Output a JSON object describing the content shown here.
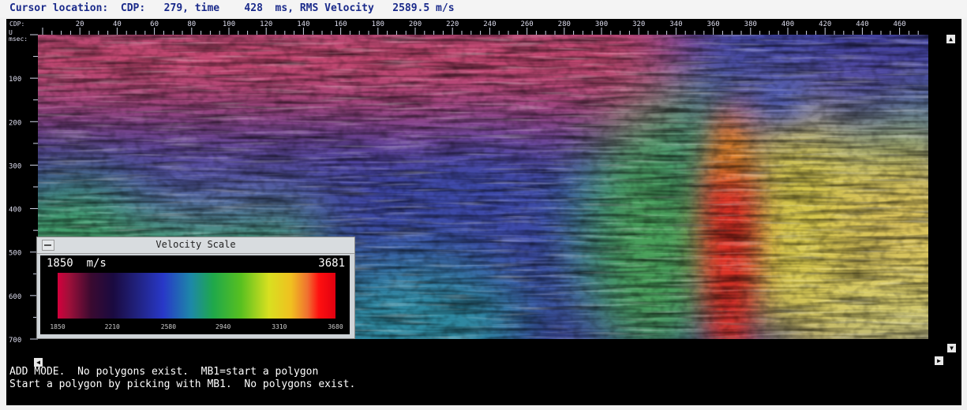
{
  "status": {
    "line": "Cursor location:  CDP:   279, time    428  ms, RMS Velocity   2589.5 m/s"
  },
  "axes": {
    "cdp_label": "CDP:",
    "time_unit_label": [
      "U",
      "msec:"
    ],
    "cdp_ticks": [
      "20",
      "40",
      "60",
      "80",
      "100",
      "120",
      "140",
      "160",
      "180",
      "200",
      "220",
      "240",
      "260",
      "280",
      "300",
      "320",
      "340",
      "360",
      "380",
      "400",
      "420",
      "440",
      "460"
    ],
    "time_ticks": [
      "100",
      "200",
      "300",
      "400",
      "500",
      "600",
      "700"
    ]
  },
  "velocity_scale": {
    "title": "Velocity Scale",
    "min_label": "1850  m/s",
    "max_label": "3681",
    "ticks": [
      "1850",
      "2210",
      "2580",
      "2940",
      "3310",
      "3680"
    ]
  },
  "messages": {
    "line1": "ADD MODE.  No polygons exist.  MB1=start a polygon",
    "line2": "Start a polygon by picking with MB1.  No polygons exist."
  },
  "colors": {
    "status_text": "#1a2a8a",
    "viewer_bg": "#000000"
  }
}
